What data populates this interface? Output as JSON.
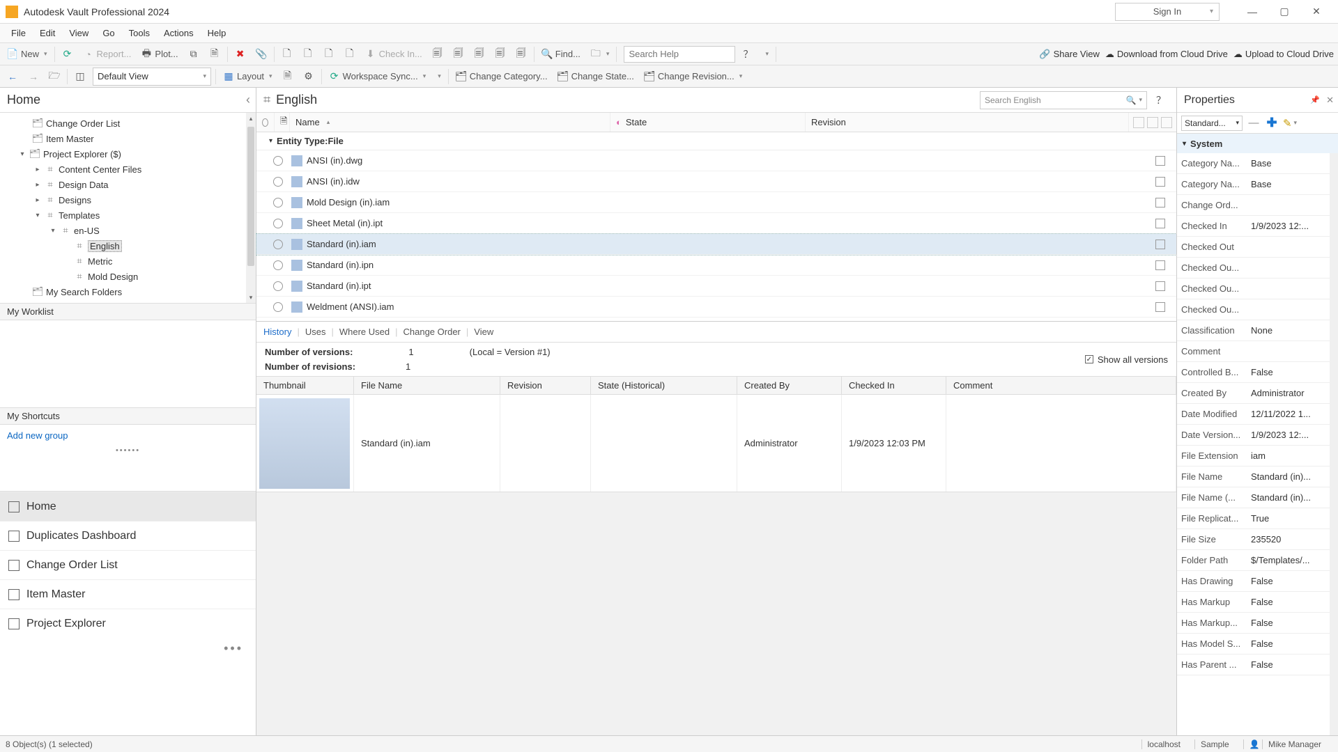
{
  "app": {
    "title": "Autodesk Vault Professional 2024",
    "signin": "Sign In"
  },
  "menu": {
    "file": "File",
    "edit": "Edit",
    "view": "View",
    "go": "Go",
    "tools": "Tools",
    "actions": "Actions",
    "help": "Help"
  },
  "toolbar1": {
    "new": "New",
    "report": "Report...",
    "plot": "Plot...",
    "checkin": "Check In...",
    "find": "Find...",
    "search_placeholder": "Search Help",
    "share_view": "Share View",
    "download_cloud": "Download from Cloud Drive",
    "upload_cloud": "Upload to Cloud Drive"
  },
  "toolbar2": {
    "default_view": "Default View",
    "layout": "Layout",
    "workspace_sync": "Workspace Sync...",
    "change_category": "Change Category...",
    "change_state": "Change State...",
    "change_revision": "Change Revision..."
  },
  "left": {
    "home": "Home",
    "tree": {
      "change_order_list": "Change Order List",
      "item_master": "Item Master",
      "project_explorer": "Project Explorer ($)",
      "content_center": "Content Center Files",
      "design_data": "Design Data",
      "designs": "Designs",
      "templates": "Templates",
      "enus": "en-US",
      "english": "English",
      "metric": "Metric",
      "mold": "Mold Design",
      "search_folders": "My Search Folders"
    },
    "worklist": "My Worklist",
    "shortcuts": "My Shortcuts",
    "add_group": "Add new group",
    "nav": {
      "home": "Home",
      "dup": "Duplicates Dashboard",
      "col": "Change Order List",
      "item": "Item Master",
      "pe": "Project Explorer"
    }
  },
  "crumb": {
    "title": "English",
    "search_placeholder": "Search English"
  },
  "grid": {
    "headers": {
      "name": "Name",
      "state": "State",
      "revision": "Revision"
    },
    "group": "Entity Type:File",
    "rows": [
      {
        "name": "ANSI (in).dwg"
      },
      {
        "name": "ANSI (in).idw"
      },
      {
        "name": "Mold Design (in).iam"
      },
      {
        "name": "Sheet Metal (in).ipt"
      },
      {
        "name": "Standard (in).iam",
        "selected": true
      },
      {
        "name": "Standard (in).ipn"
      },
      {
        "name": "Standard (in).ipt"
      },
      {
        "name": "Weldment (ANSI).iam"
      }
    ]
  },
  "detail": {
    "tabs": {
      "history": "History",
      "uses": "Uses",
      "where": "Where Used",
      "co": "Change Order",
      "view": "View"
    },
    "versions_label": "Number of versions:",
    "versions": "1",
    "local": "(Local = Version #1)",
    "revisions_label": "Number of revisions:",
    "revisions": "1",
    "showall": "Show all versions",
    "headers": {
      "thumb": "Thumbnail",
      "file": "File Name",
      "rev": "Revision",
      "state": "State (Historical)",
      "created": "Created By",
      "checked": "Checked In",
      "comment": "Comment"
    },
    "row": {
      "file": "Standard (in).iam",
      "created": "Administrator",
      "checked": "1/9/2023 12:03 PM"
    }
  },
  "props": {
    "title": "Properties",
    "selector": "Standard...",
    "system": "System",
    "items": [
      {
        "k": "Category Na...",
        "v": "Base"
      },
      {
        "k": "Category Na...",
        "v": "Base"
      },
      {
        "k": "Change Ord...",
        "v": ""
      },
      {
        "k": "Checked In",
        "v": "1/9/2023 12:..."
      },
      {
        "k": "Checked Out",
        "v": ""
      },
      {
        "k": "Checked Ou...",
        "v": ""
      },
      {
        "k": "Checked Ou...",
        "v": ""
      },
      {
        "k": "Checked Ou...",
        "v": ""
      },
      {
        "k": "Classification",
        "v": "None"
      },
      {
        "k": "Comment",
        "v": ""
      },
      {
        "k": "Controlled B...",
        "v": "False"
      },
      {
        "k": "Created By",
        "v": "Administrator"
      },
      {
        "k": "Date Modified",
        "v": "12/11/2022 1..."
      },
      {
        "k": "Date Version...",
        "v": "1/9/2023 12:..."
      },
      {
        "k": "File Extension",
        "v": "iam"
      },
      {
        "k": "File Name",
        "v": "Standard (in)..."
      },
      {
        "k": "File Name (...",
        "v": "Standard (in)..."
      },
      {
        "k": "File Replicat...",
        "v": "True"
      },
      {
        "k": "File Size",
        "v": "235520"
      },
      {
        "k": "Folder Path",
        "v": "$/Templates/..."
      },
      {
        "k": "Has Drawing",
        "v": "False"
      },
      {
        "k": "Has Markup",
        "v": "False"
      },
      {
        "k": "Has Markup...",
        "v": "False"
      },
      {
        "k": "Has Model S...",
        "v": "False"
      },
      {
        "k": "Has Parent ...",
        "v": "False"
      }
    ]
  },
  "status": {
    "left": "8 Object(s) (1 selected)",
    "host": "localhost",
    "db": "Sample",
    "user": "Mike Manager"
  }
}
